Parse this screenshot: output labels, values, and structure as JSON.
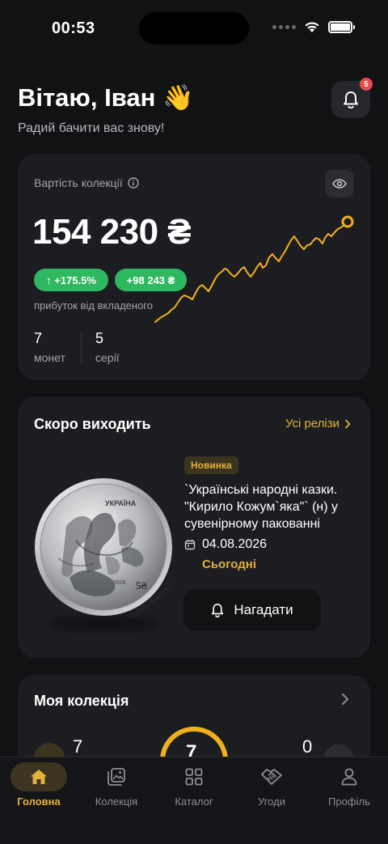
{
  "status_bar": {
    "time": "00:53"
  },
  "header": {
    "greeting": "Вітаю, Іван 👋",
    "subtitle": "Радий бачити вас знову!",
    "notifications_count": "5"
  },
  "collection_value": {
    "label": "Вартість колекції",
    "value": "154 230 ₴",
    "change_percent": "↑ +175.5%",
    "change_amount": "+98 243 ₴",
    "profit_label": "прибуток від вкладеного",
    "coins_count": "7",
    "coins_label": "монет",
    "series_count": "5",
    "series_label": "серії",
    "accent_color": "#f2b01e"
  },
  "upcoming": {
    "title": "Скоро виходить",
    "all_link": "Усі релізи",
    "badge": "Новинка",
    "release_title": "`Українські народні казки. \"Кирило Кожум`яка\"` (н) у сувенірному пакованні",
    "date": "04.08.2026",
    "when": "Сьогодні",
    "remind_button": "Нагадати",
    "coin_text": {
      "country": "УКРАЇНА",
      "year": "2026",
      "denomination": "5₴",
      "name": "Кирило Кожум'яка"
    }
  },
  "my_collection": {
    "title": "Моя колекція",
    "owned": "7",
    "center": "7",
    "other": "0"
  },
  "tabs": [
    {
      "label": "Головна",
      "icon": "home-icon",
      "active": true
    },
    {
      "label": "Колекція",
      "icon": "gallery-icon",
      "active": false
    },
    {
      "label": "Каталог",
      "icon": "grid-icon",
      "active": false
    },
    {
      "label": "Угоди",
      "icon": "handshake-icon",
      "active": false
    },
    {
      "label": "Профіль",
      "icon": "profile-icon",
      "active": false
    }
  ]
}
